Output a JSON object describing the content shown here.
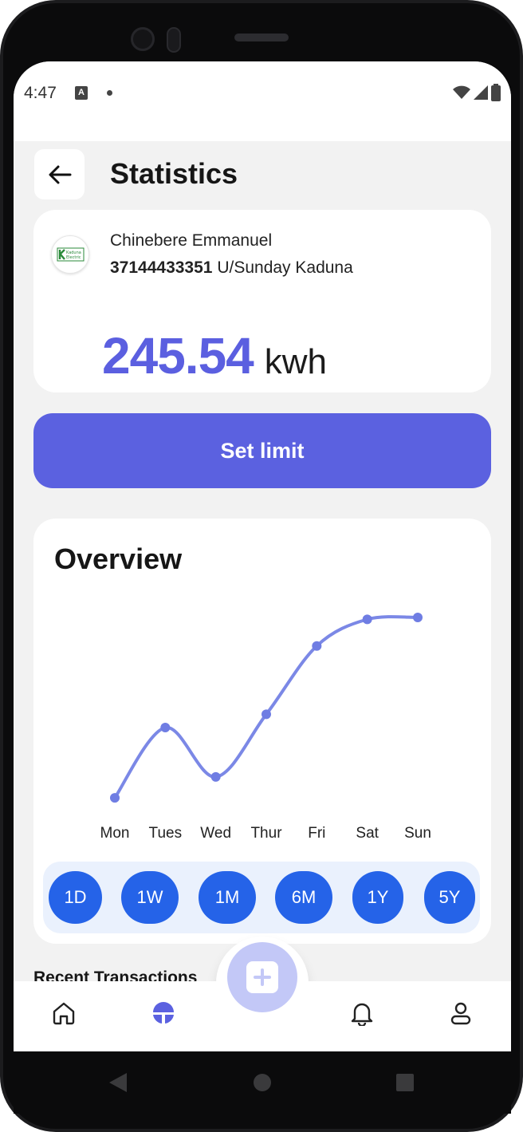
{
  "status_bar": {
    "time": "4:47",
    "notif_icon": "A"
  },
  "header": {
    "title": "Statistics",
    "back_icon": "arrow-left-icon"
  },
  "meter": {
    "customer_name": "Chinebere Emmanuel",
    "meter_number": "37144433351",
    "location": "U/Sunday Kaduna",
    "logo_text": "Kaduna Electric",
    "reading_value": "245.54",
    "reading_unit": "kwh"
  },
  "set_limit_label": "Set limit",
  "overview": {
    "title": "Overview",
    "ranges": [
      "1D",
      "1W",
      "1M",
      "6M",
      "1Y",
      "5Y"
    ]
  },
  "chart_data": {
    "type": "line",
    "categories": [
      "Mon",
      "Tues",
      "Wed",
      "Thur",
      "Fri",
      "Sat",
      "Sun"
    ],
    "values": [
      5,
      42,
      16,
      49,
      85,
      99,
      100
    ],
    "ylim": [
      0,
      100
    ],
    "grid": false,
    "color": "#7b88e6"
  },
  "recent_transactions_title": "Recent Transactions",
  "bottom_nav": {
    "items": [
      "home-icon",
      "statistics-icon",
      "add-icon",
      "bell-icon",
      "profile-icon"
    ],
    "active": "statistics-icon"
  },
  "colors": {
    "primary": "#5b61e0",
    "range_button": "#2563e8",
    "chart_line": "#7b88e6"
  }
}
